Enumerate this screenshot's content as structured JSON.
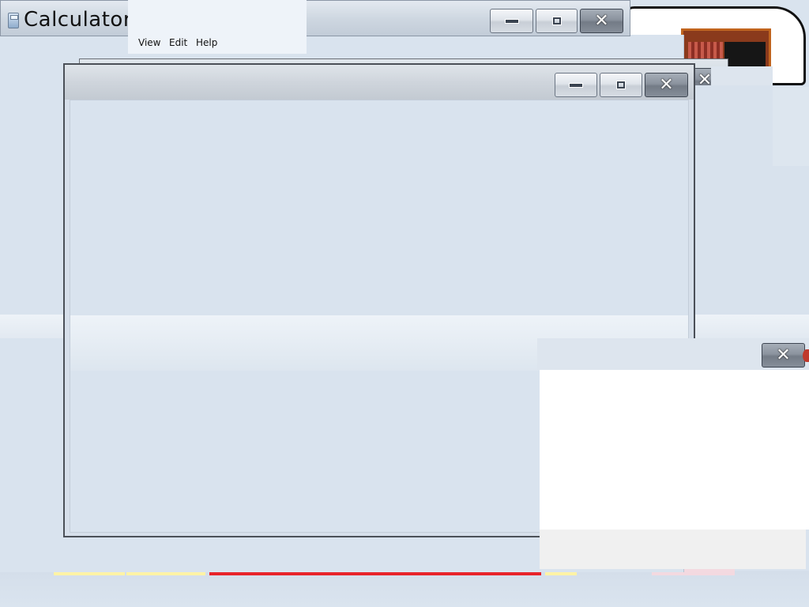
{
  "calculator": {
    "title": "Calculator",
    "menu": [
      {
        "label": "View"
      },
      {
        "label": "Edit"
      },
      {
        "label": "Help"
      }
    ],
    "caption_buttons": {
      "minimize": "minimize",
      "maximize": "maximize",
      "close": "close"
    }
  },
  "icons": {
    "app": "calculator-icon",
    "minimize": "minimize-icon",
    "maximize": "maximize-icon",
    "close": "close-icon"
  },
  "colors": {
    "window_body": "#d9e3ee",
    "close_button": "#7f8792",
    "accent_red": "#e8232a"
  }
}
